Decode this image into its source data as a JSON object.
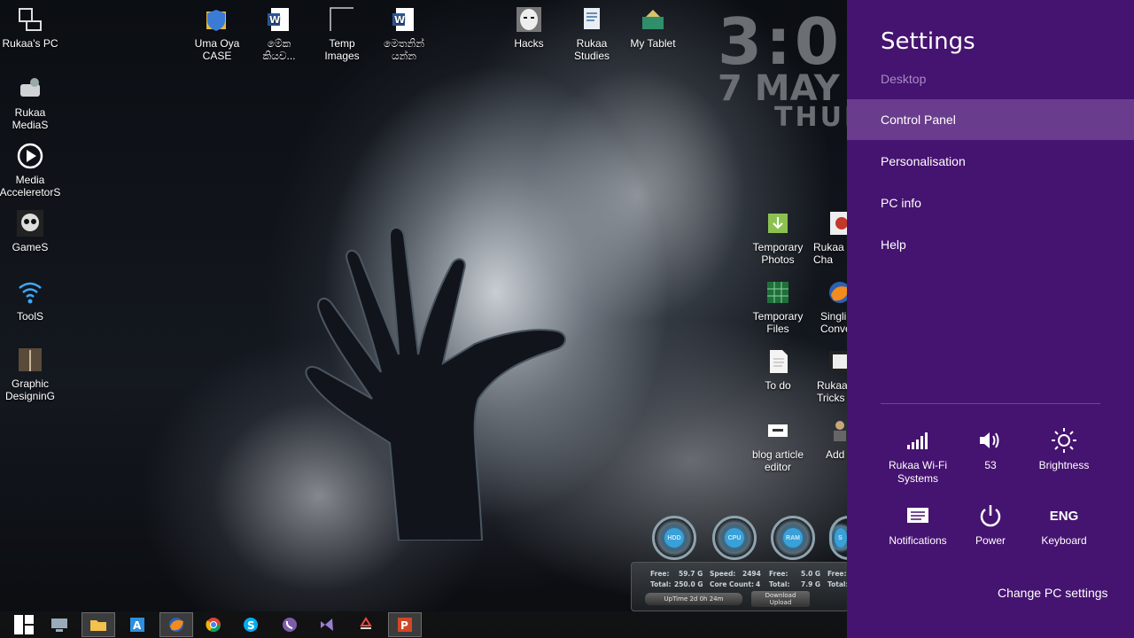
{
  "desktop": {
    "icons": [
      {
        "label": "Rukaa's PC"
      },
      {
        "label": "Rukaa\nMediaS"
      },
      {
        "label": "Media\nAcceleretorS"
      },
      {
        "label": "GameS"
      },
      {
        "label": "ToolS"
      },
      {
        "label": "Graphic\nDesigninG"
      },
      {
        "label": "Uma Oya\nCASE"
      },
      {
        "label": "මේක\nකියව..."
      },
      {
        "label": "Temp\nImages"
      },
      {
        "label": "මෙතනින්\nයන්න"
      },
      {
        "label": "Hacks"
      },
      {
        "label": "Rukaa\nStudies"
      },
      {
        "label": "My Tablet"
      },
      {
        "label": "Temporary\nPhotos"
      },
      {
        "label": "Rukaa T\nCha"
      },
      {
        "label": "Temporary\nFiles"
      },
      {
        "label": "Singli\nConve"
      },
      {
        "label": "To do"
      },
      {
        "label": "Rukaa\nTricks b"
      },
      {
        "label": "blog article\neditor"
      },
      {
        "label": "Add"
      }
    ]
  },
  "clock_widget": {
    "time": "3:0",
    "date": "7 MAY",
    "day": "THURS"
  },
  "system_monitor": {
    "dials": [
      "HDD",
      "CPU",
      "RAM",
      "S"
    ],
    "hdd": {
      "free": "Free:",
      "free_val": "59.7 G",
      "total": "Total:",
      "total_val": "250.0 G"
    },
    "cpu": {
      "speed": "Speed:",
      "speed_val": "2494",
      "cores": "Core Count:",
      "cores_val": "4"
    },
    "ram": {
      "free": "Free:",
      "free_val": "5.0 G",
      "total": "Total:",
      "total_val": "7.9 G"
    },
    "extra": {
      "free": "Free:",
      "total": "Total:"
    },
    "uptime": "UpTime  2d 0h 24m",
    "net": "Download\nUpload"
  },
  "taskbar": {
    "buttons": [
      "start",
      "desktop-app",
      "file-explorer",
      "store",
      "firefox",
      "chrome",
      "skype",
      "viber",
      "visual-studio",
      "recycle-tool",
      "powerpoint"
    ]
  },
  "settings_charm": {
    "title": "Settings",
    "subtitle": "Desktop",
    "menu": [
      "Control Panel",
      "Personalisation",
      "PC info",
      "Help"
    ],
    "selected": "Control Panel",
    "quick": [
      {
        "label": "Rukaa Wi-Fi\nSystems",
        "icon": "wifi-signal-icon"
      },
      {
        "label": "53",
        "icon": "speaker-icon"
      },
      {
        "label": "Brightness",
        "icon": "brightness-icon"
      },
      {
        "label": "Notifications",
        "icon": "notifications-icon"
      },
      {
        "label": "Power",
        "icon": "power-icon"
      },
      {
        "label": "Keyboard",
        "icon": "keyboard-icon",
        "glyph": "ENG"
      }
    ],
    "change_pc_settings": "Change PC settings"
  },
  "colors": {
    "charm_bg": "#451370",
    "charm_selected": "#6a3c8d",
    "charm_subtle": "#a98bc4"
  }
}
